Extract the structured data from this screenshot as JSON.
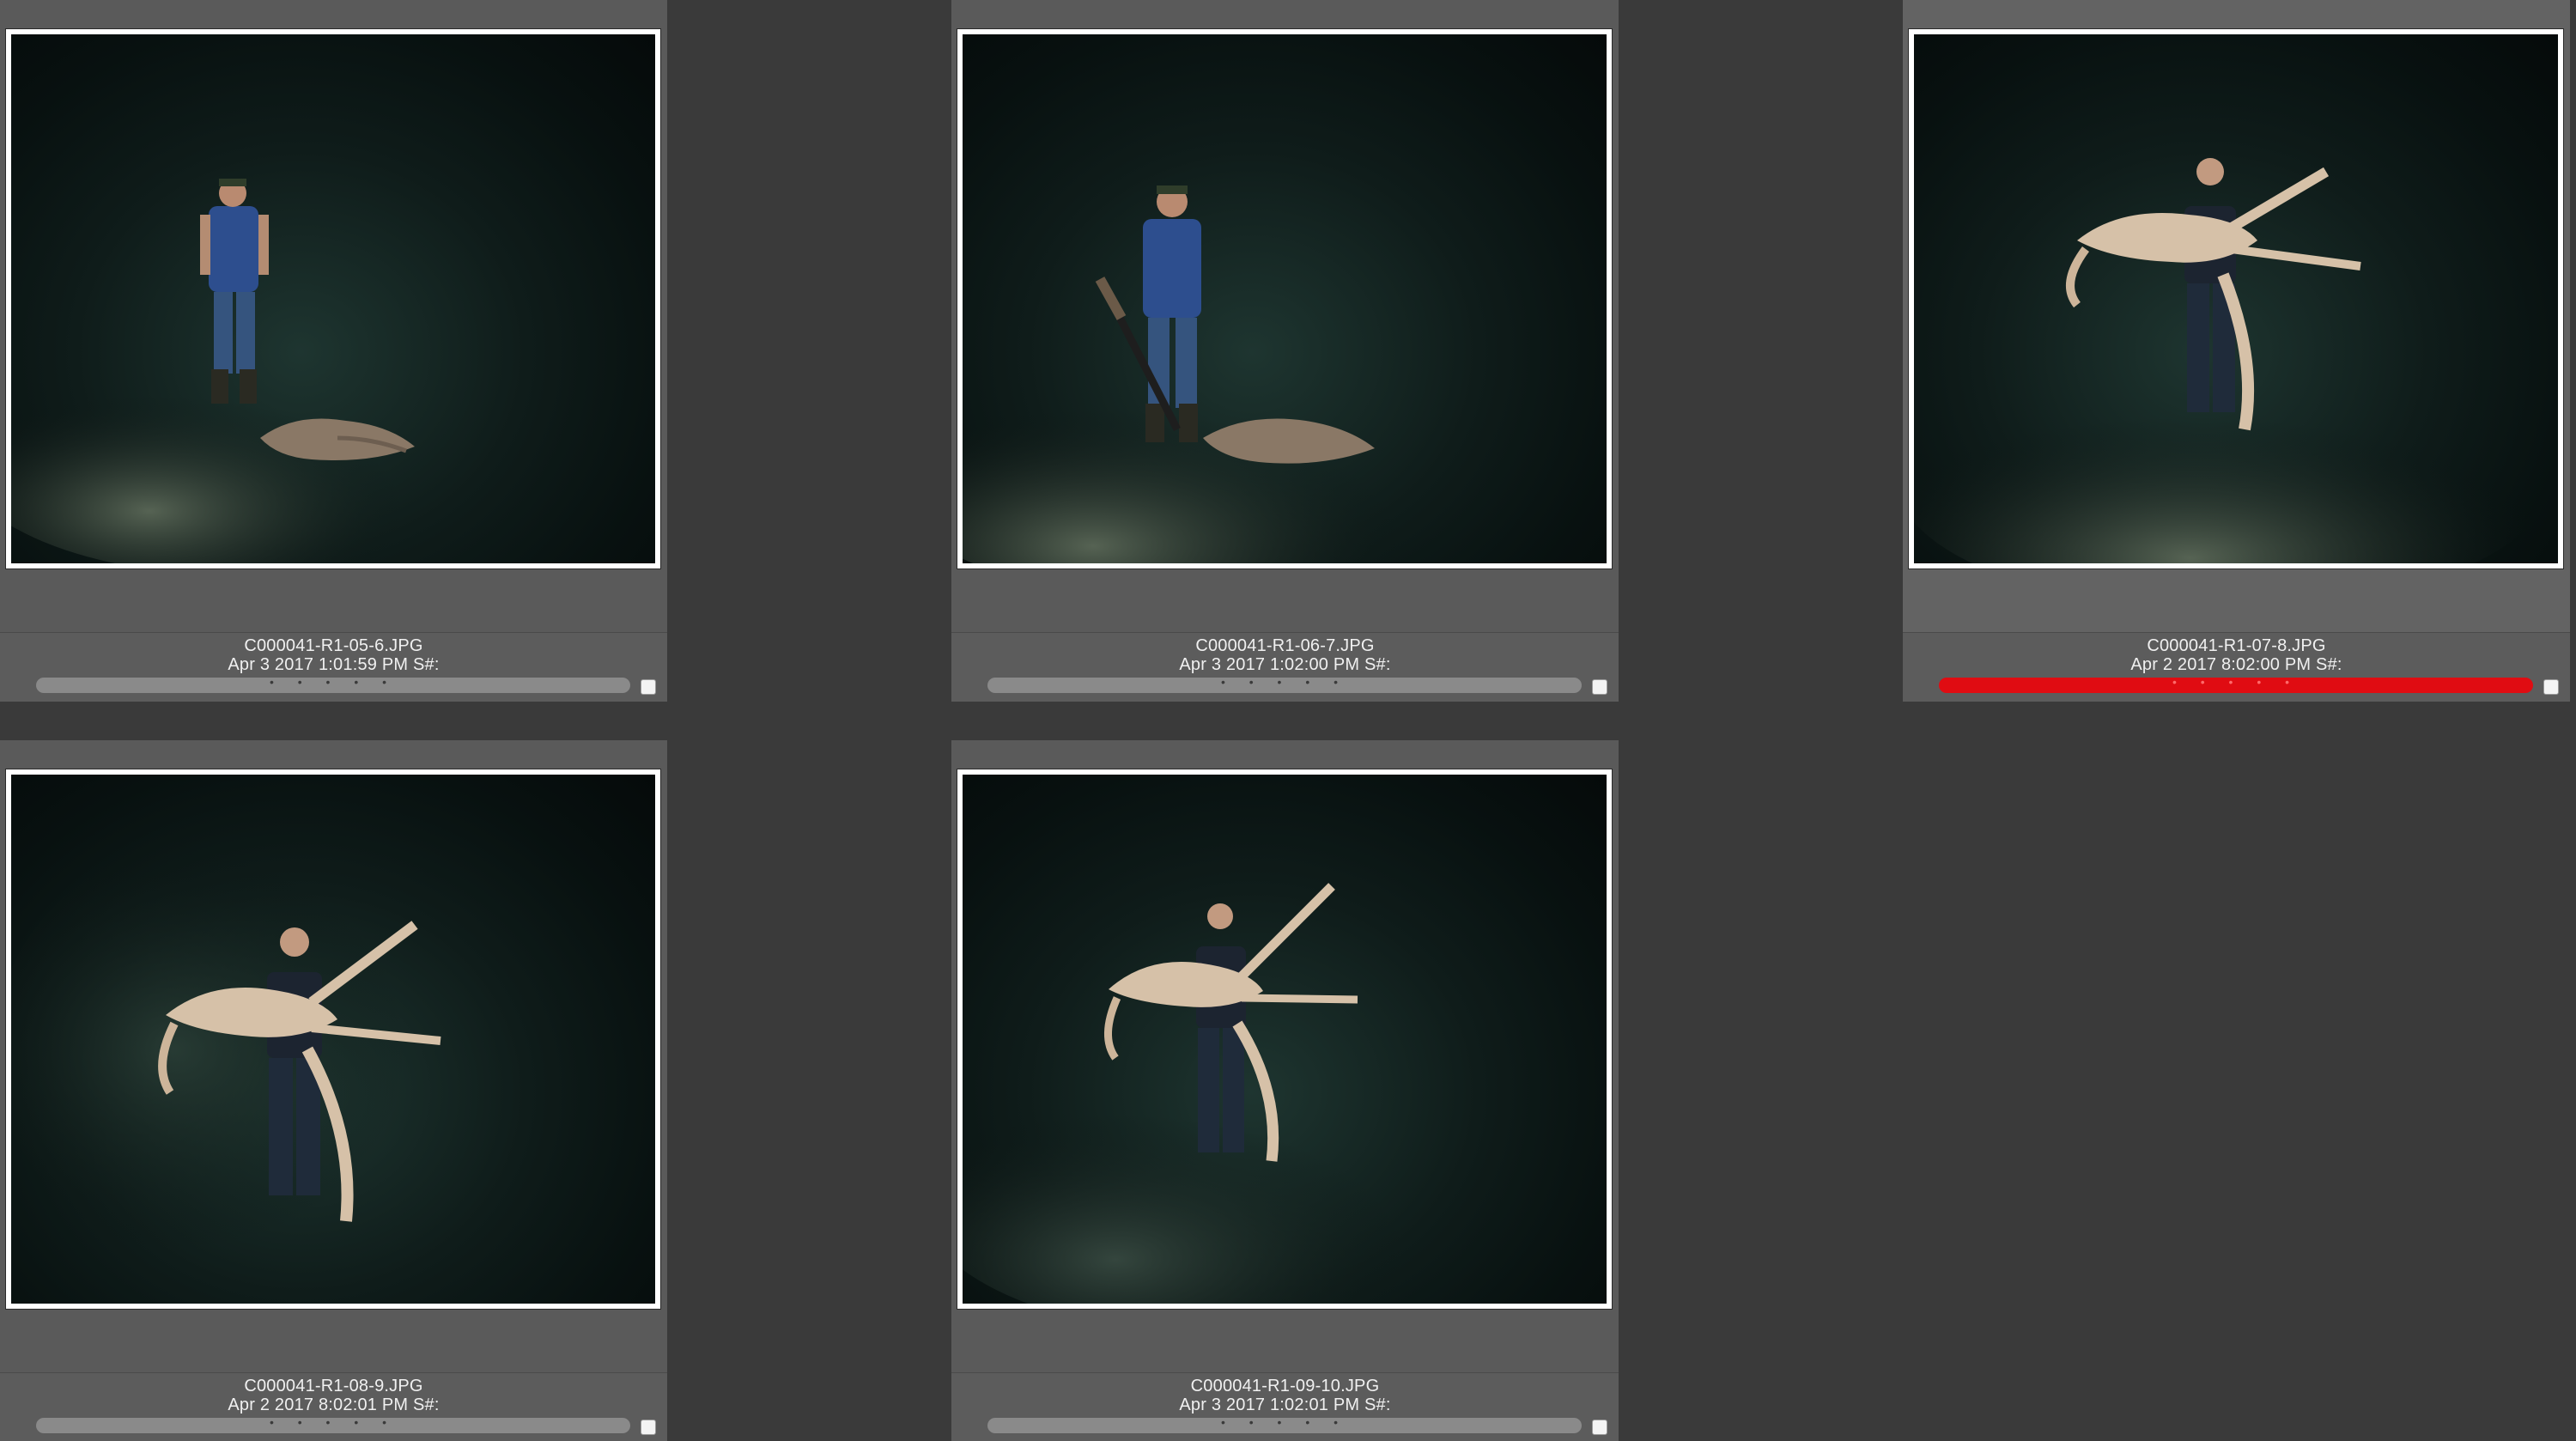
{
  "thumbnails": [
    {
      "filename": "C000041-R1-05-6.JPG",
      "datetime": "Apr 3 2017 1:01:59 PM S#:",
      "stars": "• • • • •",
      "label_color": "#8a8a8a"
    },
    {
      "filename": "C000041-R1-06-7.JPG",
      "datetime": "Apr 3 2017 1:02:00 PM S#:",
      "stars": "• • • • •",
      "label_color": "#8a8a8a"
    },
    {
      "filename": "C000041-R1-07-8.JPG",
      "datetime": "Apr 2 2017 8:02:00 PM S#:",
      "stars": "• • • • •",
      "label_color": "#e00c12"
    },
    {
      "filename": "C000041-R1-08-9.JPG",
      "datetime": "Apr 2 2017 8:02:01 PM S#:",
      "stars": "• • • • •",
      "label_color": "#8a8a8a"
    },
    {
      "filename": "C000041-R1-09-10.JPG",
      "datetime": "Apr 3 2017 1:02:01 PM S#:",
      "stars": "• • • • •",
      "label_color": "#8a8a8a"
    }
  ]
}
